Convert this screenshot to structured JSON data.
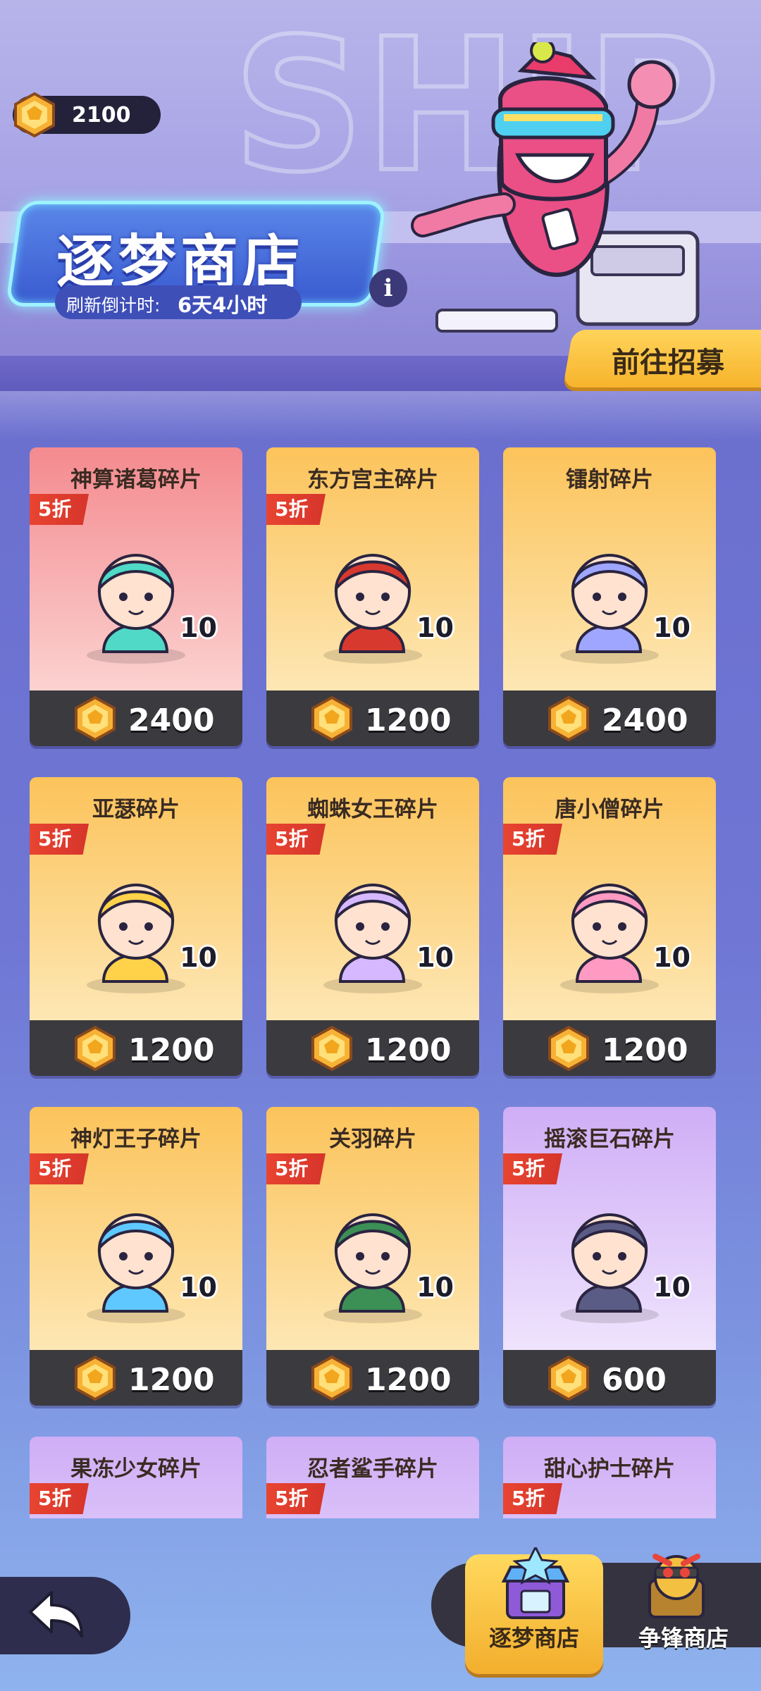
{
  "header": {
    "currency_value": "2100",
    "shop_title": "逐梦商店",
    "refresh_label": "刷新倒计时:",
    "refresh_value": "6天4小时",
    "info_label": "i",
    "recruit_button": "前往招募"
  },
  "items": [
    {
      "name": "神算诸葛碎片",
      "discount": "5折",
      "qty": "10",
      "price": "2400",
      "theme": "red"
    },
    {
      "name": "东方宫主碎片",
      "discount": "5折",
      "qty": "10",
      "price": "1200",
      "theme": "gold"
    },
    {
      "name": "镭射碎片",
      "discount": "",
      "qty": "10",
      "price": "2400",
      "theme": "gold"
    },
    {
      "name": "亚瑟碎片",
      "discount": "5折",
      "qty": "10",
      "price": "1200",
      "theme": "gold"
    },
    {
      "name": "蜘蛛女王碎片",
      "discount": "5折",
      "qty": "10",
      "price": "1200",
      "theme": "gold"
    },
    {
      "name": "唐小僧碎片",
      "discount": "5折",
      "qty": "10",
      "price": "1200",
      "theme": "gold"
    },
    {
      "name": "神灯王子碎片",
      "discount": "5折",
      "qty": "10",
      "price": "1200",
      "theme": "gold"
    },
    {
      "name": "关羽碎片",
      "discount": "5折",
      "qty": "10",
      "price": "1200",
      "theme": "gold"
    },
    {
      "name": "摇滚巨石碎片",
      "discount": "5折",
      "qty": "10",
      "price": "600",
      "theme": "purple"
    },
    {
      "name": "果冻少女碎片",
      "discount": "5折",
      "qty": "",
      "price": "",
      "theme": "purple"
    },
    {
      "name": "忍者鲨手碎片",
      "discount": "5折",
      "qty": "",
      "price": "",
      "theme": "purple"
    },
    {
      "name": "甜心护士碎片",
      "discount": "5折",
      "qty": "",
      "price": "",
      "theme": "purple"
    }
  ],
  "bottom_nav": {
    "tab_active": "逐梦商店",
    "tab_2": "争锋商店"
  },
  "colors": {
    "gold_card": "#fcc860",
    "red_card": "#f6868a",
    "purple_card": "#d3b8f6",
    "price_bar": "#3b3a3f",
    "discount": "#e84431"
  }
}
